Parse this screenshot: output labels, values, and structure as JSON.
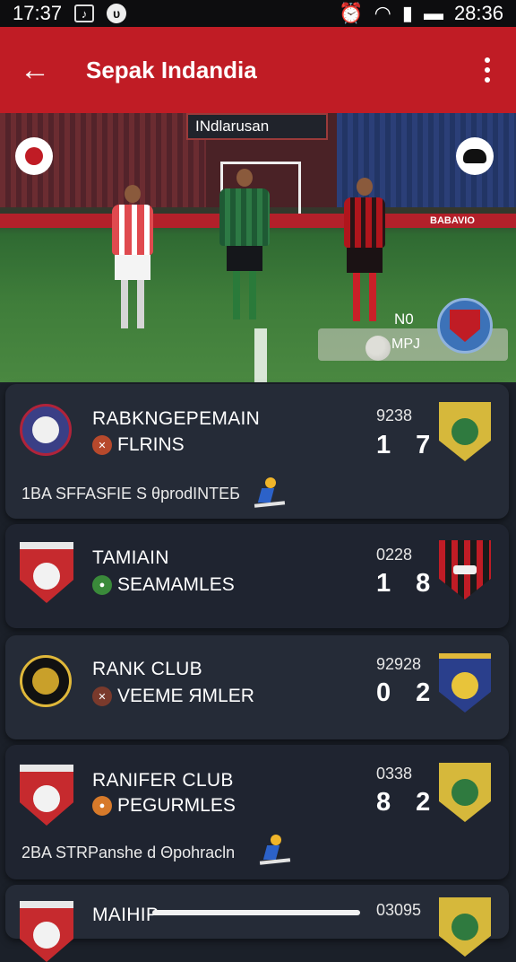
{
  "status_bar": {
    "time": "17:37",
    "clock": "28:36"
  },
  "app_bar": {
    "title": "Sepak Indandia"
  },
  "hero": {
    "scoreboard_text": "INdlarusan",
    "adboard_text": "BABAVIO",
    "overlay_line1": "N0",
    "overlay_line2": "MPJ"
  },
  "matches": [
    {
      "team1": "RABKNGEPEMAIN",
      "team2": "FLRINS",
      "time": "9238",
      "score": "1 7",
      "footer": "1BA SFFASFIE S θprodINTEБ"
    },
    {
      "team1": "TAMIAIN",
      "team2": "SEAMAMLES",
      "time": "0228",
      "score": "1 8",
      "footer": ""
    },
    {
      "team1": "RANK CLUB",
      "team2": "VEEME ЯMLER",
      "time": "92928",
      "score": "0 2",
      "footer": ""
    },
    {
      "team1": "RANIFER CLUB",
      "team2": "PEGURMLES",
      "time": "0338",
      "score": "8 2",
      "footer": "2BA STRPanshe d Θpohracln"
    },
    {
      "team1": "MAIHIP",
      "team2": "",
      "time": "03095",
      "score": "",
      "footer": ""
    }
  ],
  "colors": {
    "app_bar": "#c01c25",
    "card": "#252b37",
    "background": "#1b2029"
  },
  "icons": [
    "back-arrow-icon",
    "more-vert-icon",
    "team-crest-icon",
    "runner-icon"
  ]
}
